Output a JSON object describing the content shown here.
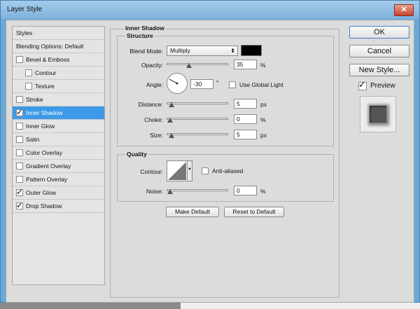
{
  "window": {
    "title": "Layer Style",
    "close_glyph": "✕"
  },
  "styles": {
    "header": "Styles",
    "blending": "Blending Options: Default",
    "items": [
      {
        "label": "Bevel & Emboss",
        "checked": false
      },
      {
        "label": "Contour",
        "checked": false
      },
      {
        "label": "Texture",
        "checked": false
      },
      {
        "label": "Stroke",
        "checked": false
      },
      {
        "label": "Inner Shadow",
        "checked": true
      },
      {
        "label": "Inner Glow",
        "checked": false
      },
      {
        "label": "Satin",
        "checked": false
      },
      {
        "label": "Color Overlay",
        "checked": false
      },
      {
        "label": "Gradient Overlay",
        "checked": false
      },
      {
        "label": "Pattern Overlay",
        "checked": false
      },
      {
        "label": "Outer Glow",
        "checked": true
      },
      {
        "label": "Drop Shadow",
        "checked": true
      }
    ],
    "check_glyph": "✓"
  },
  "inner_shadow": {
    "title": "Inner Shadow",
    "structure": "Structure",
    "blend_mode_label": "Blend Mode:",
    "blend_mode": "Multiply",
    "color": "#000000",
    "opacity_label": "Opacity:",
    "opacity": "35",
    "opacity_level": 0.35,
    "angle_label": "Angle:",
    "angle": "-30",
    "degree": "°",
    "global_light_label": "Use Global Light",
    "global_light": false,
    "distance_label": "Distance:",
    "distance": "5",
    "distance_level": 0.02,
    "choke_label": "Choke:",
    "choke": "0",
    "choke_level": 0.0,
    "size_label": "Size:",
    "size": "5",
    "size_level": 0.02,
    "percent": "%",
    "px": "px"
  },
  "quality": {
    "title": "Quality",
    "contour_label": "Contour:",
    "anti_aliased_label": "Anti-aliased",
    "anti_aliased": false,
    "noise_label": "Noise:",
    "noise": "0",
    "noise_level": 0.0,
    "make_default": "Make Default",
    "reset_default": "Reset to Default"
  },
  "actions": {
    "ok": "OK",
    "cancel": "Cancel",
    "new_style": "New Style...",
    "preview_label": "Preview",
    "preview": true
  }
}
